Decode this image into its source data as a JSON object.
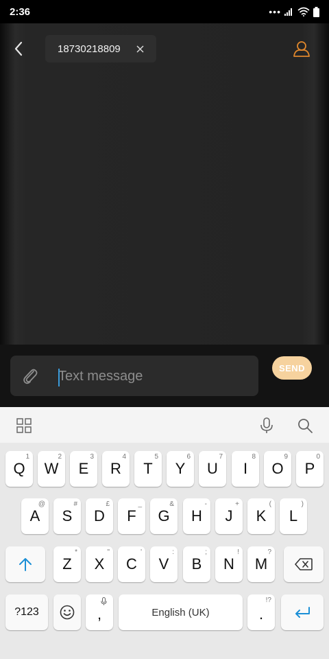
{
  "status_bar": {
    "time": "2:36",
    "icons": [
      "more-dots-icon",
      "signal-icon",
      "wifi-icon",
      "battery-icon"
    ]
  },
  "header": {
    "back_icon": "chevron-left-icon",
    "recipient": "18730218809",
    "contact_icon": "person-icon"
  },
  "composer": {
    "placeholder": "Text message",
    "value": "",
    "send_label": "SEND",
    "attach_icon": "paperclip-icon"
  },
  "keyboard": {
    "toolbar": [
      "grid-icon",
      "microphone-icon",
      "search-icon"
    ],
    "row1": [
      {
        "label": "Q",
        "hint": "1"
      },
      {
        "label": "W",
        "hint": "2"
      },
      {
        "label": "E",
        "hint": "3"
      },
      {
        "label": "R",
        "hint": "4"
      },
      {
        "label": "T",
        "hint": "5"
      },
      {
        "label": "Y",
        "hint": "6"
      },
      {
        "label": "U",
        "hint": "7"
      },
      {
        "label": "I",
        "hint": "8"
      },
      {
        "label": "O",
        "hint": "9"
      },
      {
        "label": "P",
        "hint": "0"
      }
    ],
    "row2": [
      {
        "label": "A",
        "hint": "@"
      },
      {
        "label": "S",
        "hint": "#"
      },
      {
        "label": "D",
        "hint": "£"
      },
      {
        "label": "F",
        "hint": "_"
      },
      {
        "label": "G",
        "hint": "&"
      },
      {
        "label": "H",
        "hint": "-"
      },
      {
        "label": "J",
        "hint": "+"
      },
      {
        "label": "K",
        "hint": "("
      },
      {
        "label": "L",
        "hint": ")"
      }
    ],
    "row3": [
      {
        "label": "Z",
        "hint": "*"
      },
      {
        "label": "X",
        "hint": "\""
      },
      {
        "label": "C",
        "hint": "'"
      },
      {
        "label": "V",
        "hint": ":"
      },
      {
        "label": "B",
        "hint": ";"
      },
      {
        "label": "N",
        "hint": "!"
      },
      {
        "label": "M",
        "hint": "?"
      }
    ],
    "symbols_label": "?123",
    "comma_label": ",",
    "space_label": "English (UK)",
    "period_label": ".",
    "period_hint": "!?",
    "accent_color": "#1a8fd6"
  }
}
